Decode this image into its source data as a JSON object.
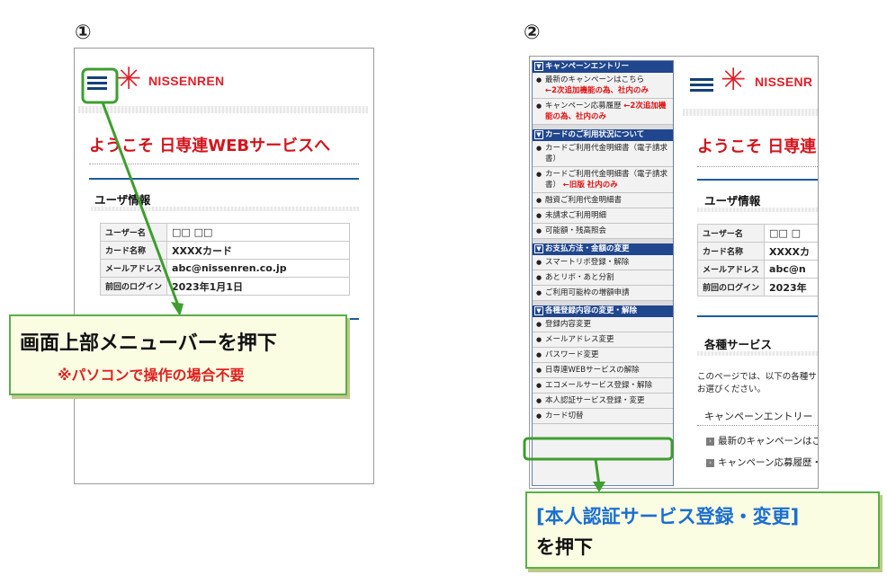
{
  "step1": {
    "number": "①",
    "logo_text": "NISSENREN",
    "welcome_title": "ようこそ 日専連WEBサービスへ",
    "user_info_heading": "ユーザ情報",
    "rows": [
      {
        "label": "ユーザー名",
        "value": "□□ □□"
      },
      {
        "label": "カード名称",
        "value": "XXXXカード"
      },
      {
        "label": "メールアドレス",
        "value": "abc@nissenren.co.jp"
      },
      {
        "label": "前回のログイン",
        "value": "2023年1月1日"
      }
    ],
    "callout_main": "画面上部メニューバーを押下",
    "callout_note": "※パソコンで操作の場合不要"
  },
  "step2": {
    "number": "②",
    "logo_text": "NISSENR",
    "welcome_title": "ようこそ 日専連",
    "user_info_heading": "ユーザ情報",
    "rows": [
      {
        "label": "ユーザー名",
        "value": "□□ □"
      },
      {
        "label": "カード名称",
        "value": "XXXXカ"
      },
      {
        "label": "メールアドレス",
        "value": "abc@n"
      },
      {
        "label": "前回のログイン",
        "value": "2023年"
      }
    ],
    "services_heading": "各種サービス",
    "services_desc_1": "このページでは、以下の各種サ",
    "services_desc_2": "お選びください。",
    "campaign_heading": "キャンペーンエントリー",
    "campaign_links": [
      "最新のキャンペーンはこ",
      "キャンペーン応募履歴・"
    ],
    "menu": {
      "sections": [
        {
          "title": "キャンペーンエントリー",
          "items": [
            {
              "text": "最新のキャンペーンはこちら",
              "red": "←2次追加機能の為、社内のみ"
            },
            {
              "text": "キャンペーン応募履歴",
              "red": "←2次追加機能の為、社内のみ"
            }
          ]
        },
        {
          "title": "カードのご利用状況について",
          "items": [
            {
              "text": "カードご利用代金明細書（電子請求書）",
              "red": ""
            },
            {
              "text": "カードご利用代金明細書（電子請求書）",
              "red": "←旧版 社内のみ"
            },
            {
              "text": "融資ご利用代金明細書",
              "red": ""
            },
            {
              "text": "未請求ご利用明細",
              "red": ""
            },
            {
              "text": "可能額・残高照会",
              "red": ""
            }
          ]
        },
        {
          "title": "お支払方法・金額の変更",
          "items": [
            {
              "text": "スマートリボ登録・解除",
              "red": ""
            },
            {
              "text": "あとリボ・あと分割",
              "red": ""
            },
            {
              "text": "ご利用可能枠の増額申請",
              "red": ""
            }
          ]
        },
        {
          "title": "各種登録内容の変更・解除",
          "items": [
            {
              "text": "登録内容変更",
              "red": ""
            },
            {
              "text": "メールアドレス変更",
              "red": ""
            },
            {
              "text": "パスワード変更",
              "red": ""
            },
            {
              "text": "日専連WEBサービスの解除",
              "red": ""
            },
            {
              "text": "エコメールサービス登録・解除",
              "red": ""
            },
            {
              "text": "本人認証サービス登録・変更",
              "red": ""
            },
            {
              "text": "カード切替",
              "red": ""
            }
          ]
        }
      ]
    },
    "callout_line1": "[本人認証サービス登録・変更]",
    "callout_line2": "を押下"
  },
  "colors": {
    "brand_red": "#e0202a",
    "menu_blue": "#20468e",
    "callout_green": "#58b047",
    "arrow_green": "#3e9e2e"
  }
}
